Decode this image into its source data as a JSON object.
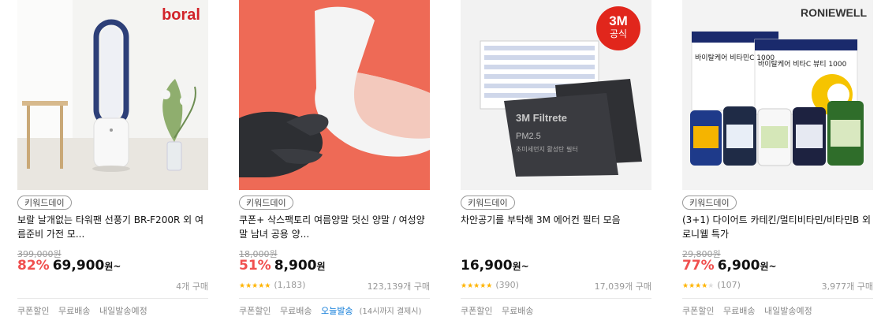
{
  "products": [
    {
      "brand_logo": "boral",
      "badge": "키워드데이",
      "title": "보랄 날개없는 타워팬 선풍기 BR-F200R 외 여름준비 가전 모...",
      "original_price": "399,000원",
      "discount": "82%",
      "price": "69,900",
      "price_unit": "원~",
      "sold": "4개 구매",
      "tags": [
        "쿠폰할인",
        "무료배송",
        "내일발송예정"
      ]
    },
    {
      "badge": "키워드데이",
      "title": "쿠폰+ 삭스팩토리 여름양말 덧신 양말 / 여성양말 남녀 공용 양...",
      "original_price": "18,000원",
      "discount": "51%",
      "price": "8,900",
      "price_unit": "원",
      "rating": "4.5",
      "reviews": "(1,183)",
      "sold": "123,139개 구매",
      "tags": [
        "쿠폰할인",
        "무료배송"
      ],
      "highlight_tag": "오늘발송",
      "highlight_note": "(14시까지 결제시)"
    },
    {
      "box_brand": "3M",
      "box_brand_sub": "공식",
      "box_label": "3M Filtrete",
      "box_sublabel": "PM2.5",
      "box_desc": "초미세먼지 활성탄 필터",
      "badge": "키워드데이",
      "title": "차안공기를 부탁해 3M 에어컨 필터 모음",
      "price": "16,900",
      "price_unit": "원~",
      "rating": "4.5",
      "reviews": "(390)",
      "sold": "17,039개 구매",
      "tags": [
        "쿠폰할인",
        "무료배송"
      ]
    },
    {
      "brand_logo": "RONIEWELL",
      "box_text_1": "바이탈케어 비타민C 1000",
      "box_text_2": "바이탈케어 비타C 뷰티 1000",
      "badge": "키워드데이",
      "title": "(3+1) 다이어트 카테킨/멀티비타민/비타민B 외 로니웰 특가",
      "original_price": "29,800원",
      "discount": "77%",
      "price": "6,900",
      "price_unit": "원~",
      "rating": "4.0",
      "reviews": "(107)",
      "sold": "3,977개 구매",
      "tags": [
        "쿠폰할인",
        "무료배송",
        "내일발송예정"
      ]
    }
  ],
  "colors": {
    "discount": "#f0504f",
    "star": "#ffb400",
    "highlight": "#0a79d8",
    "card2_bg": "#ee6a56"
  }
}
